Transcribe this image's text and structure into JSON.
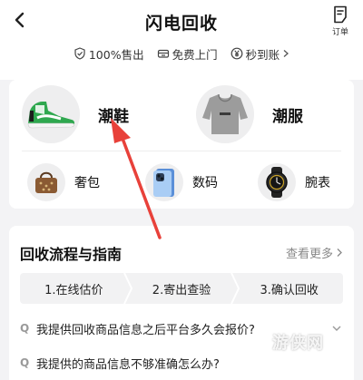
{
  "header": {
    "title": "闪电回收",
    "order_label": "订单"
  },
  "perks": [
    {
      "icon": "shield-check-icon",
      "label": "100%售出"
    },
    {
      "icon": "truck-icon",
      "label": "免费上门"
    },
    {
      "icon": "yen-coin-icon",
      "label": "秒到账"
    }
  ],
  "categories": {
    "primary": [
      {
        "icon": "sneaker-image",
        "label": "潮鞋"
      },
      {
        "icon": "hoodie-image",
        "label": "潮服"
      }
    ],
    "secondary": [
      {
        "icon": "handbag-image",
        "label": "奢包"
      },
      {
        "icon": "phone-image",
        "label": "数码"
      },
      {
        "icon": "watch-image",
        "label": "腕表"
      }
    ]
  },
  "guide": {
    "title": "回收流程与指南",
    "see_more": "查看更多",
    "steps": [
      "1.在线估价",
      "2.寄出查验",
      "3.确认回收"
    ],
    "faq_marker": "Q",
    "faqs": [
      "我提供回收商品信息之后平台多久会报价?",
      "我提供的商品信息不够准确怎么办?"
    ]
  },
  "watermark": "游侠网",
  "colors": {
    "annotation_arrow": "#e8413a",
    "sneaker_green": "#2fa84f",
    "background": "#f3f3f5"
  }
}
